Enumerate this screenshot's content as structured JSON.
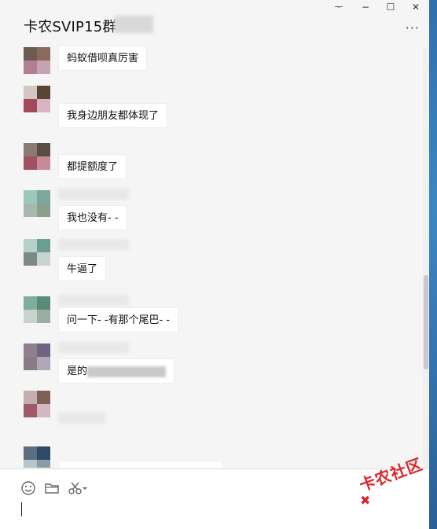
{
  "window": {
    "title": "卡农SVIP15群",
    "controls": {
      "pin": "ᅮ",
      "minimize": "−",
      "maximize": "☐",
      "close": "✕"
    },
    "more": "···"
  },
  "messages": [
    {
      "text": "蚂蚁借呗真厉害",
      "avatar": [
        "#6e5a52",
        "#8a6a5c",
        "#b07f92",
        "#c6a3b2"
      ]
    },
    {
      "text": "我身边朋友都体现了",
      "avatar": [
        "#d4c6c2",
        "#c0a9a2",
        "#8b7568",
        "#5a4434",
        "#a34a5a",
        "#d9b3c0"
      ]
    },
    {
      "text": "都提额度了",
      "avatar": [
        "#8c7a72",
        "#5a4d46",
        "#a05060",
        "#c88a98"
      ]
    },
    {
      "text": "我也没有- -",
      "avatar": [
        "#9cc8bc",
        "#7aa89a",
        "#a8b8b0",
        "#88a08c"
      ]
    },
    {
      "text": "牛逼了",
      "avatar": [
        "#b5d2ca",
        "#6a9e92",
        "#7c8a86",
        "#c8d4cf"
      ]
    },
    {
      "text": "问一下- -有那个尾巴- -",
      "avatar": [
        "#7faf98",
        "#5c8a78",
        "#c8d2ce",
        "#9aaea4"
      ]
    },
    {
      "text": "是的",
      "avatar": [
        "#8e7f8e",
        "#6e6482",
        "#8a7a88",
        "#b0a6b4"
      ]
    },
    {
      "text": "",
      "avatar": [
        "#c4aeb0",
        "#7e6054",
        "#a0586a",
        "#d4b8c0"
      ]
    },
    {
      "text": "",
      "avatar": [
        "#5a6e80",
        "#2f4a66",
        "#b8c4cc",
        "#8a9ca8"
      ]
    }
  ],
  "toolbar": {
    "emoji_icon": "smiley-icon",
    "folder_icon": "folder-icon",
    "scissors_icon": "scissors-icon"
  },
  "watermark": {
    "text": "卡农社区",
    "color": "#d9262c"
  }
}
